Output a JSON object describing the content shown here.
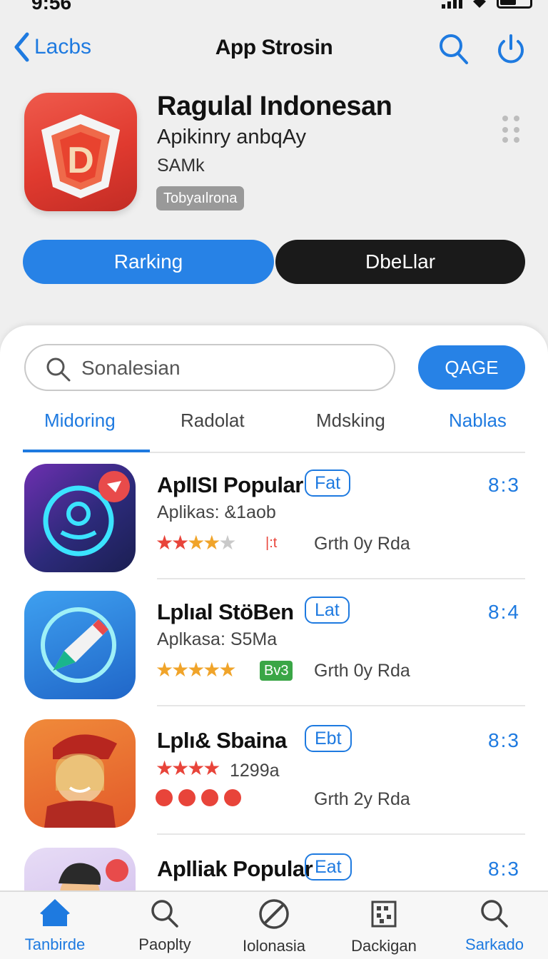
{
  "status": {
    "time": "9:56"
  },
  "nav": {
    "back_label": "Lacbs",
    "title": "App Strosin"
  },
  "app": {
    "name": "Ragulal Indonesan",
    "subtitle": "Apikinry anbqAy",
    "developer": "SAMk",
    "tag": "Tobyaılrona",
    "icon_letter": "D"
  },
  "actions": {
    "primary": "Rarking",
    "secondary": "DbeLlar"
  },
  "search": {
    "value": "Sonalesian",
    "button": "QAGE"
  },
  "tabs": [
    "Midoring",
    "Radolat",
    "Mdsking",
    "Nablas"
  ],
  "list": [
    {
      "name": "AplISI Popular",
      "badge": "Fat",
      "sub": "Aplikas: &1aob",
      "stars": 4,
      "small": "|:t",
      "meta": "Grth 0y Rda",
      "score": "8:3"
    },
    {
      "name": "Lplıal StöBen",
      "badge": "Lat",
      "sub": "Aplkasa: S5Ma",
      "stars": 5,
      "green": "Bv3",
      "meta": "Grth 0y Rda",
      "score": "8:4"
    },
    {
      "name": "Lplı& Sbaina",
      "badge": "Ebt",
      "sub": "1299a",
      "stars": 4,
      "meta": "Grth 2y Rda",
      "score": "8:3"
    },
    {
      "name": "Aplliak Popular",
      "badge": "Eat",
      "score": "8:3"
    }
  ],
  "tabbar": [
    "Tanbirde",
    "Paoplty",
    "Iolonasia",
    "Dackigan",
    "Sarkado"
  ],
  "colors": {
    "accent": "#1e7ae0",
    "button_blue": "#2782e6",
    "button_dark": "#1a1a1a",
    "app_icon_red": "#e03a2f"
  }
}
